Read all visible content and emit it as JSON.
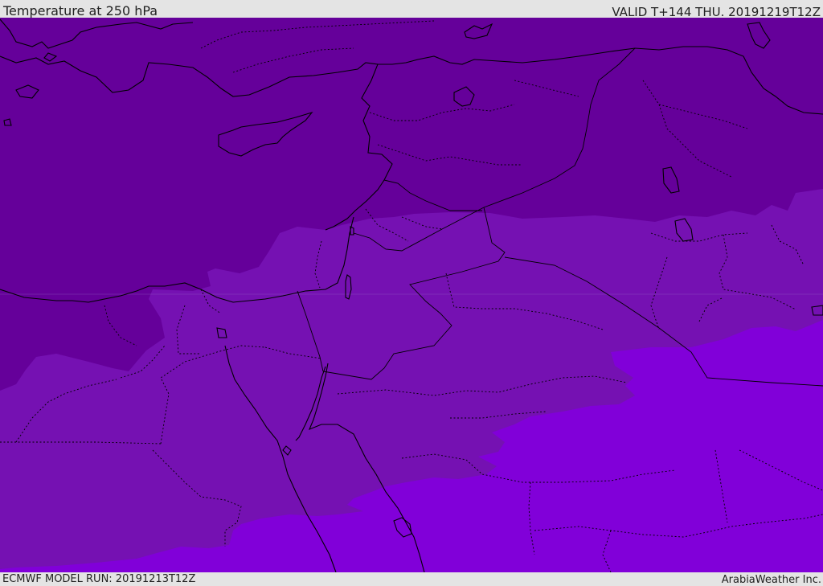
{
  "header": {
    "title": "Temperature at 250 hPa",
    "valid_time": "VALID T+144 THU. 20191219T12Z"
  },
  "footer": {
    "model_run": "ECMWF MODEL RUN: 20191213T12Z",
    "credit": "ArabiaWeather Inc."
  },
  "colors": {
    "band_cold": "#65009a",
    "band_mid": "#7511b2",
    "band_warm": "#8100d9",
    "coastline": "#000000",
    "border": "#000000",
    "background": "#e4e4e4"
  }
}
